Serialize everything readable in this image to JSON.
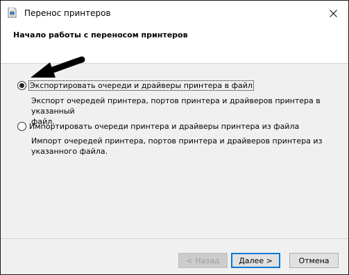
{
  "window": {
    "title": "Перенос принтеров",
    "close_icon": "close-icon",
    "app_icon": "document-printer-icon"
  },
  "header": {
    "title": "Начало работы с переносом принтеров"
  },
  "options": [
    {
      "label": "Экспортировать очереди и драйверы принтера в файл",
      "desc_line1": "Экспорт очередей принтера, портов принтера и драйверов принтера в указанный",
      "desc_line2": "файл.",
      "checked": true
    },
    {
      "label": "Импортировать очереди принтера и драйверы принтера из файла",
      "desc_line1": "Импорт очередей принтера, портов принтера и драйверов принтера из",
      "desc_line2": "указанного файла.",
      "checked": false
    }
  ],
  "buttons": {
    "back": "< Назад",
    "next": "Далее >",
    "cancel": "Отмена"
  },
  "annotation": {
    "arrow_icon": "black-arrow-pointer",
    "color": "#000000"
  }
}
